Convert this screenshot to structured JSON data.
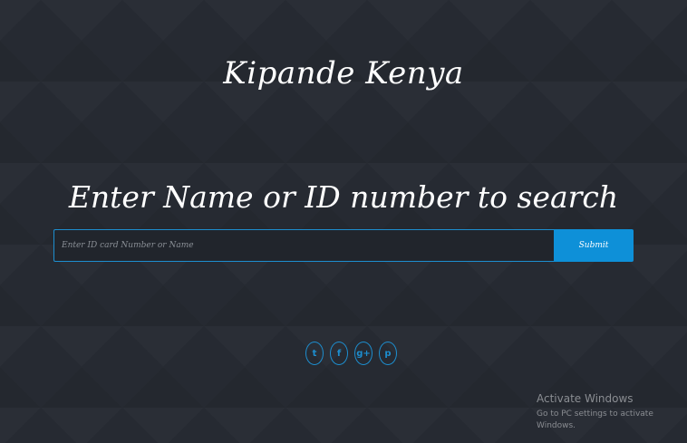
{
  "brand": {
    "title": "Kipande Kenya"
  },
  "search": {
    "heading": "Enter Name or ID number to search",
    "placeholder": "Enter ID card Number or Name",
    "submit_label": "Submit"
  },
  "social": [
    {
      "icon": "twitter-icon",
      "glyph": "t"
    },
    {
      "icon": "facebook-icon",
      "glyph": "f"
    },
    {
      "icon": "google-plus-icon",
      "glyph": "g+"
    },
    {
      "icon": "pinterest-icon",
      "glyph": "p"
    }
  ],
  "watermark": {
    "title": "Activate Windows",
    "subtitle": "Go to PC settings to activate Windows."
  },
  "colors": {
    "background": "#262a32",
    "accent": "#0e90d8"
  }
}
